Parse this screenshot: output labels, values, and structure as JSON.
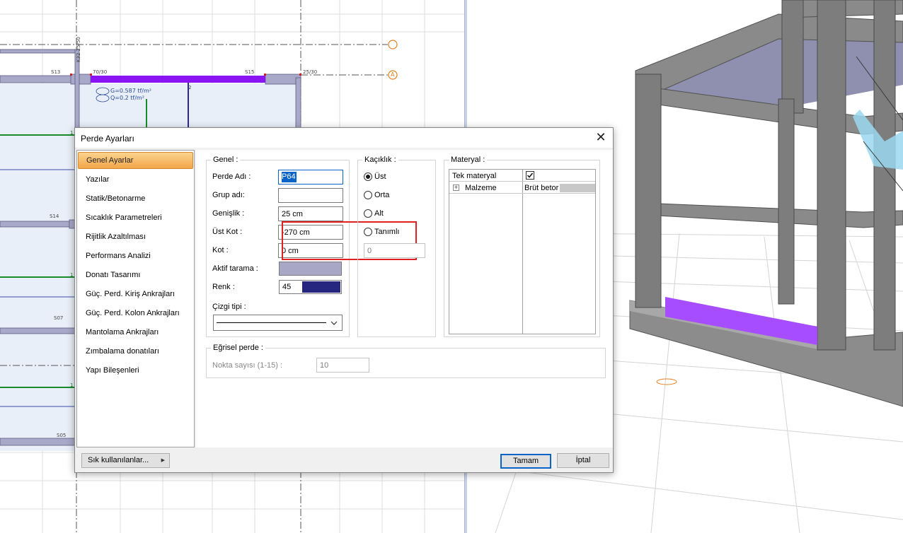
{
  "plan": {
    "labels": {
      "s13": "S13",
      "b70": "70/30",
      "s15": "S15",
      "b25": "25/30",
      "k32": "K32 25/50",
      "s14": "S14",
      "s07": "S07",
      "s05": "S05",
      "axis_a": "A",
      "n1": "1",
      "n2": "1",
      "n3": "1",
      "n4": "1",
      "n5": "2"
    },
    "load_g": "G=0.587 tf/m²",
    "load_q": "Q=0.2 tf/m²"
  },
  "dialog": {
    "title": "Perde Ayarları",
    "close_glyph": "✕",
    "nav_items": [
      "Genel Ayarlar",
      "Yazılar",
      "Statik/Betonarme",
      "Sıcaklık Parametreleri",
      "Rijitlik Azaltılması",
      "Performans Analizi",
      "Donatı Tasarımı",
      "Güç. Perd. Kiriş Ankrajları",
      "Güç. Perd. Kolon Ankrajları",
      "Mantolama Ankrajları",
      "Zımbalama donatıları",
      "Yapı Bileşenleri"
    ],
    "active_nav": 0,
    "genel": {
      "title": "Genel :",
      "perde_adi_label": "Perde Adı :",
      "perde_adi_value": "P64",
      "grup_adi_label": "Grup adı:",
      "grup_adi_value": "",
      "genislik_label": "Genişlik :",
      "genislik_value": "25 cm",
      "ust_kot_label": "Üst Kot :",
      "ust_kot_value": "-270 cm",
      "kot_label": "Kot :",
      "kot_value": "0 cm",
      "aktif_tarama_label": "Aktif tarama :",
      "aktif_tarama_color": "#a9a7c6",
      "renk_label": "Renk :",
      "renk_value": "45",
      "renk_color": "#262680",
      "cizgi_tipi_label": "Çizgi tipi :"
    },
    "kaciklik": {
      "title": "Kaçıklık :",
      "options": [
        "Üst",
        "Orta",
        "Alt",
        "Tanımlı"
      ],
      "selected": 0,
      "value": "0"
    },
    "materyal": {
      "title": "Materyal :",
      "row1_label": "Tek materyal",
      "row1_checked": true,
      "row2_label": "Malzeme",
      "row2_expand": "+",
      "row2_value": "Brüt betor"
    },
    "egrisel": {
      "title": "Eğrisel perde :",
      "nokta_label": "Nokta sayısı (1-15) :",
      "nokta_value": "10"
    },
    "buttons": {
      "sik": "Sık kullanılanlar...",
      "sik_arrow": "▶",
      "ok": "Tamam",
      "cancel": "İptal"
    }
  },
  "colors": {
    "highlight": "#e02020",
    "nav_active": "#f3a64a",
    "purple_beam": "#8b14f5",
    "green_axis": "#1a8a2a"
  }
}
